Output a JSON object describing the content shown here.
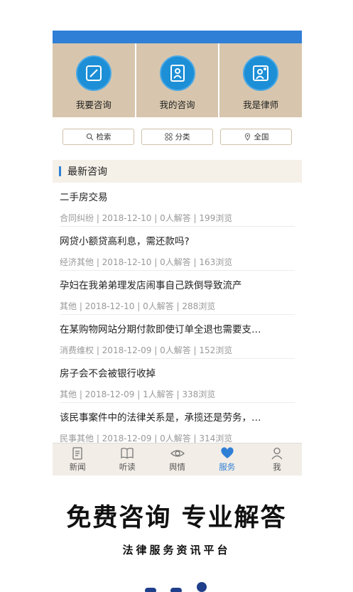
{
  "actions": [
    {
      "label": "我要咨询",
      "icon": "edit-icon"
    },
    {
      "label": "我的咨询",
      "icon": "profile-card-icon"
    },
    {
      "label": "我是律师",
      "icon": "lawyer-icon"
    }
  ],
  "filters": {
    "search": "检索",
    "category": "分类",
    "region": "全国"
  },
  "section": {
    "title": "最新咨询"
  },
  "consultations": [
    {
      "title": "二手房交易",
      "meta": "合同纠纷 | 2018-12-10 | 0人解答 | 199浏览"
    },
    {
      "title": "网贷小额贷高利息，需还款吗?",
      "meta": "经济其他 | 2018-12-10 | 0人解答 | 163浏览"
    },
    {
      "title": "孕妇在我弟弟理发店闹事自己跌倒导致流产",
      "meta": "其他 | 2018-12-10 | 0人解答 | 288浏览"
    },
    {
      "title": "在某购物网站分期付款即使订单全退也需要支…",
      "meta": "消费维权 | 2018-12-09 | 0人解答 | 152浏览"
    },
    {
      "title": "房子会不会被银行收掉",
      "meta": "其他 | 2018-12-09 | 1人解答 | 338浏览"
    },
    {
      "title": "该民事案件中的法律关系是，承揽还是劳务，…",
      "meta": "民事其他 | 2018-12-09 | 0人解答 | 314浏览"
    }
  ],
  "tabs": [
    {
      "label": "新闻",
      "active": false
    },
    {
      "label": "听读",
      "active": false
    },
    {
      "label": "舆情",
      "active": false
    },
    {
      "label": "服务",
      "active": true
    },
    {
      "label": "我",
      "active": false
    }
  ],
  "headline": "免费咨询  专业解答",
  "subline": "法律服务资讯平台",
  "colors": {
    "accent": "#2f7fd6",
    "panel": "#d7c6ad"
  }
}
